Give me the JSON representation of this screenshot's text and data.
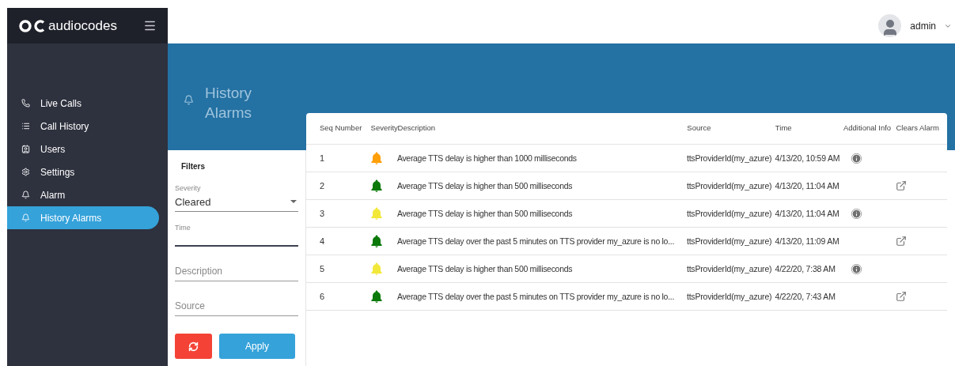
{
  "brand": {
    "name": "audiocodes"
  },
  "user": {
    "name": "admin"
  },
  "sidebar": {
    "items": [
      {
        "label": "Live Calls",
        "kind": "phone",
        "selected": false
      },
      {
        "label": "Call History",
        "kind": "list",
        "selected": false
      },
      {
        "label": "Users",
        "kind": "users",
        "selected": false
      },
      {
        "label": "Settings",
        "kind": "settings",
        "selected": false
      },
      {
        "label": "Alarm",
        "kind": "bell",
        "selected": false
      },
      {
        "label": "History Alarms",
        "kind": "bell",
        "selected": true
      }
    ]
  },
  "page": {
    "title": "History Alarms"
  },
  "filters": {
    "title": "Filters",
    "severity": {
      "label": "Severity",
      "value": "Cleared"
    },
    "time": {
      "label": "Time"
    },
    "description": {
      "placeholder": "Description"
    },
    "source": {
      "placeholder": "Source"
    },
    "apply_label": "Apply"
  },
  "table": {
    "columns": [
      "Seq Number",
      "Severity",
      "Description",
      "Source",
      "Time",
      "Additional Info",
      "Clears Alarm"
    ],
    "rows": [
      {
        "seq": "1",
        "color": "#ff9f0a",
        "description": "Average TTS delay is higher than 1000 milliseconds",
        "source": "ttsProviderId(my_azure)",
        "time": "4/13/20, 10:59 AM",
        "info": true,
        "clears": false
      },
      {
        "seq": "2",
        "color": "#0b7a0b",
        "description": "Average TTS delay is higher than 500 milliseconds",
        "source": "ttsProviderId(my_azure)",
        "time": "4/13/20, 11:04 AM",
        "info": false,
        "clears": true
      },
      {
        "seq": "3",
        "color": "#f2e83a",
        "description": "Average TTS delay is higher than 500 milliseconds",
        "source": "ttsProviderId(my_azure)",
        "time": "4/13/20, 11:04 AM",
        "info": true,
        "clears": false
      },
      {
        "seq": "4",
        "color": "#0b7a0b",
        "description": "Average TTS delay over the past 5 minutes on TTS provider my_azure is no lo...",
        "source": "ttsProviderId(my_azure)",
        "time": "4/13/20, 11:09 AM",
        "info": false,
        "clears": true
      },
      {
        "seq": "5",
        "color": "#f2e83a",
        "description": "Average TTS delay is higher than 500 milliseconds",
        "source": "ttsProviderId(my_azure)",
        "time": "4/22/20, 7:38 AM",
        "info": true,
        "clears": false
      },
      {
        "seq": "6",
        "color": "#0b7a0b",
        "description": "Average TTS delay over the past 5 minutes on TTS provider my_azure is no lo...",
        "source": "ttsProviderId(my_azure)",
        "time": "4/22/20, 7:43 AM",
        "info": false,
        "clears": true
      }
    ]
  }
}
